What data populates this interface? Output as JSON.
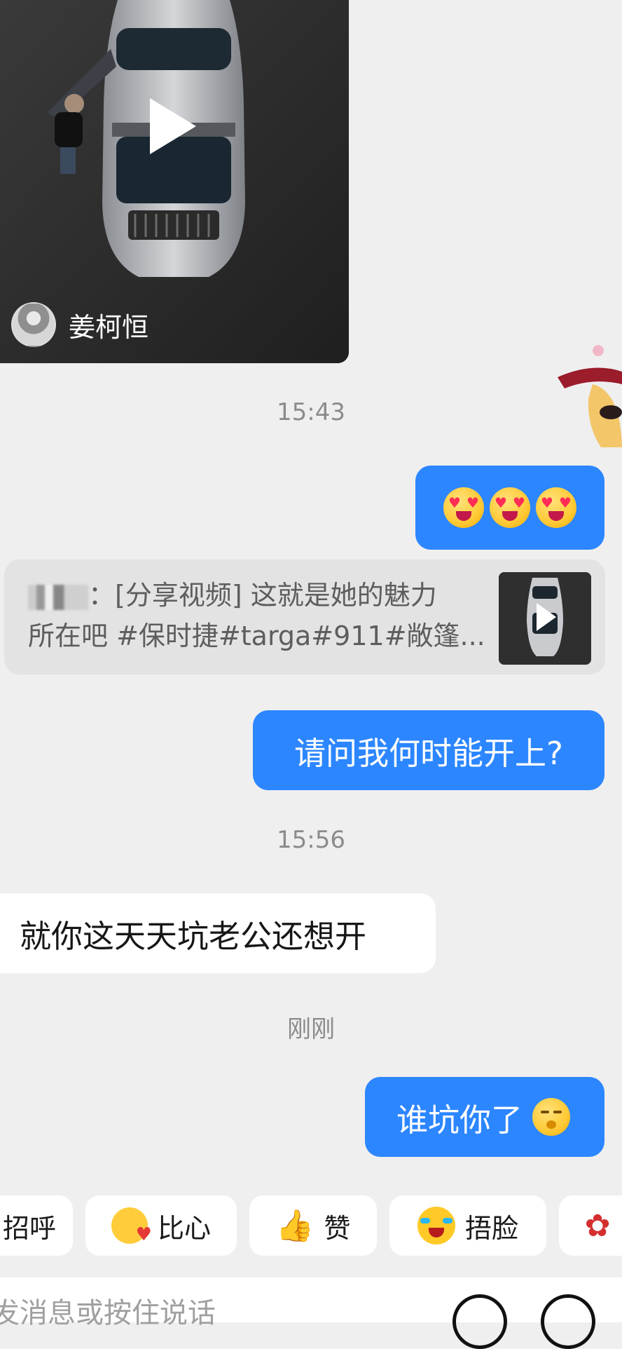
{
  "video_card": {
    "author_name": "姜柯恒"
  },
  "timestamps": [
    "15:43",
    "15:56",
    "刚刚"
  ],
  "messages": {
    "emoji_message_label": "heart-eyes ×3",
    "question": "请问我何时能开上?",
    "reply": "就你这天天坑老公还想开",
    "answer": "谁坑你了"
  },
  "shared_video": {
    "prefix": "：[分享视频] 这就是她的魅力",
    "line2": "所在吧 #保时捷#targa#911#敞篷..."
  },
  "quick_replies": [
    {
      "label": "招呼",
      "icon": "wave-icon"
    },
    {
      "label": "比心",
      "icon": "duck-heart-icon"
    },
    {
      "label": "赞",
      "icon": "thumbs-up-icon"
    },
    {
      "label": "捂脸",
      "icon": "facepalm-icon"
    },
    {
      "label": "",
      "icon": "rose-icon"
    }
  ],
  "input": {
    "placeholder": "发消息或按住说话"
  },
  "colors": {
    "bubble_blue": "#2c86ff",
    "background": "#efefef"
  }
}
